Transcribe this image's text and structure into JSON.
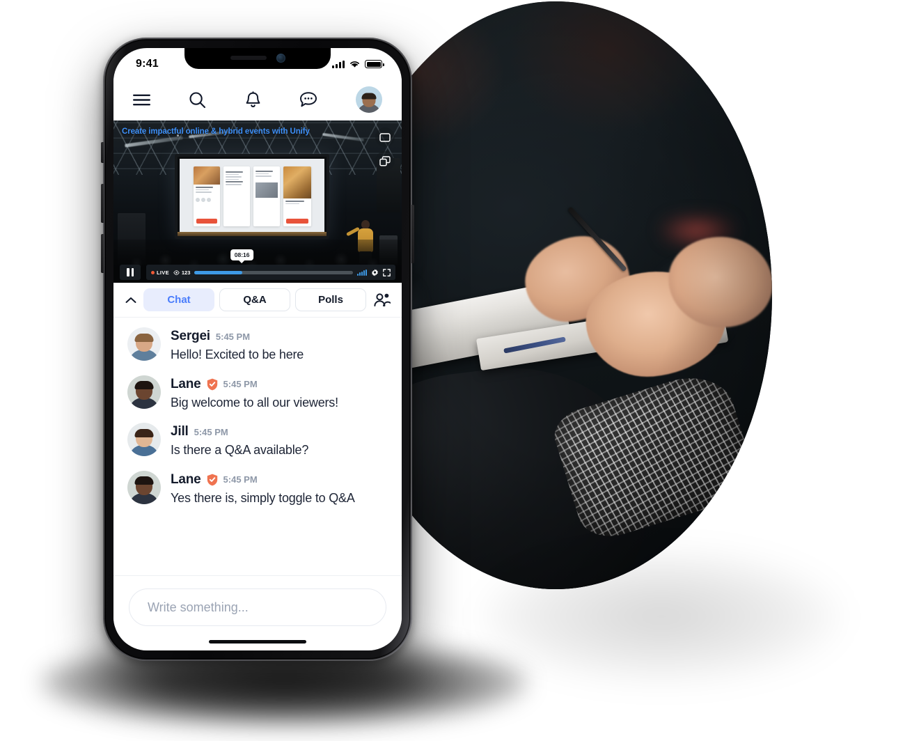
{
  "status_bar": {
    "time": "9:41",
    "signal_icon": "cellular-signal-icon",
    "wifi_icon": "wifi-icon",
    "battery_icon": "battery-icon"
  },
  "top_nav": {
    "menu_icon": "hamburger-menu-icon",
    "search_icon": "search-icon",
    "notifications_icon": "bell-icon",
    "messages_icon": "chat-bubble-icon",
    "avatar": "user-avatar"
  },
  "player": {
    "title": "Create impactful online & hybrid events with Unify",
    "title_color": "#3d8ff7",
    "overlay_buttons": [
      {
        "name": "screen-share-icon"
      },
      {
        "name": "picture-in-picture-icon"
      }
    ],
    "controls": {
      "play_state_icon": "pause-icon",
      "live_label": "LIVE",
      "live_dot_color": "#f05a36",
      "viewers_icon": "eye-icon",
      "viewers_count": "123",
      "progress_percent": 30,
      "progress_color": "#3e9ae6",
      "tooltip_time": "08:16",
      "quality_icon": "signal-bars-icon",
      "settings_icon": "gear-icon",
      "fullscreen_icon": "expand-icon"
    }
  },
  "tabs": {
    "collapse_icon": "chevron-up-icon",
    "items": [
      {
        "label": "Chat",
        "active": true
      },
      {
        "label": "Q&A",
        "active": false
      },
      {
        "label": "Polls",
        "active": false
      }
    ],
    "participants_icon": "people-icon",
    "active_bg": "#e8edfd",
    "active_fg": "#4a7dfc"
  },
  "chat": {
    "messages": [
      {
        "name": "Sergei",
        "time": "5:45 PM",
        "text": "Hello! Excited to be here",
        "verified": false,
        "avatar": {
          "skin": "#d8a886",
          "hair": "#8a6440",
          "shirt": "#5f7f9c",
          "bg": "#eceff2"
        }
      },
      {
        "name": "Lane",
        "time": "5:45 PM",
        "text": "Big welcome to all our viewers!",
        "verified": true,
        "avatar": {
          "skin": "#6b4530",
          "hair": "#1d1410",
          "shirt": "#2c3340",
          "bg": "#cfd6d2"
        }
      },
      {
        "name": "Jill",
        "time": "5:45 PM",
        "text": "Is there a Q&A available?",
        "verified": false,
        "avatar": {
          "skin": "#e0b694",
          "hair": "#3a2418",
          "shirt": "#4a7096",
          "bg": "#e6eaec"
        }
      },
      {
        "name": "Lane",
        "time": "5:45 PM",
        "text": "Yes there is, simply toggle to Q&A",
        "verified": true,
        "avatar": {
          "skin": "#6b4530",
          "hair": "#1d1410",
          "shirt": "#2c3340",
          "bg": "#cfd6d2"
        }
      }
    ],
    "verified_badge_icon": "verified-shield-icon",
    "verified_badge_color": "#ef7350"
  },
  "composer": {
    "placeholder": "Write something...",
    "value": ""
  },
  "home_indicator": "home-indicator"
}
